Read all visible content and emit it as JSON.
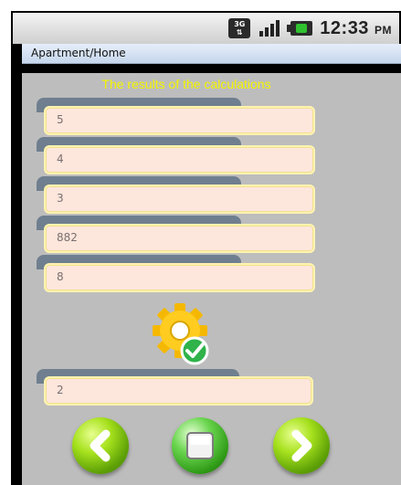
{
  "status_bar": {
    "network_badge_top": "3G",
    "network_badge_bottom": "⇅",
    "time": "12:33",
    "ampm": "PM"
  },
  "title_bar": {
    "title": "Apartment/Home"
  },
  "main": {
    "heading": "The results of the calculations",
    "results": [
      {
        "value": "5"
      },
      {
        "value": "4"
      },
      {
        "value": "3"
      },
      {
        "value": "882"
      },
      {
        "value": "8"
      }
    ],
    "bottom_result": {
      "value": "2"
    },
    "gear_icon": "gear-with-check-icon"
  },
  "nav": {
    "back_icon": "back-arrow-icon",
    "stop_icon": "stop-icon",
    "next_icon": "forward-arrow-icon"
  },
  "colors": {
    "heading": "#f4f400",
    "background": "#bdbdbd",
    "field_fill": "#fde6dc",
    "field_border": "#fff3b0",
    "tab": "#6f7f8f",
    "accent_green": "#5fa207"
  }
}
